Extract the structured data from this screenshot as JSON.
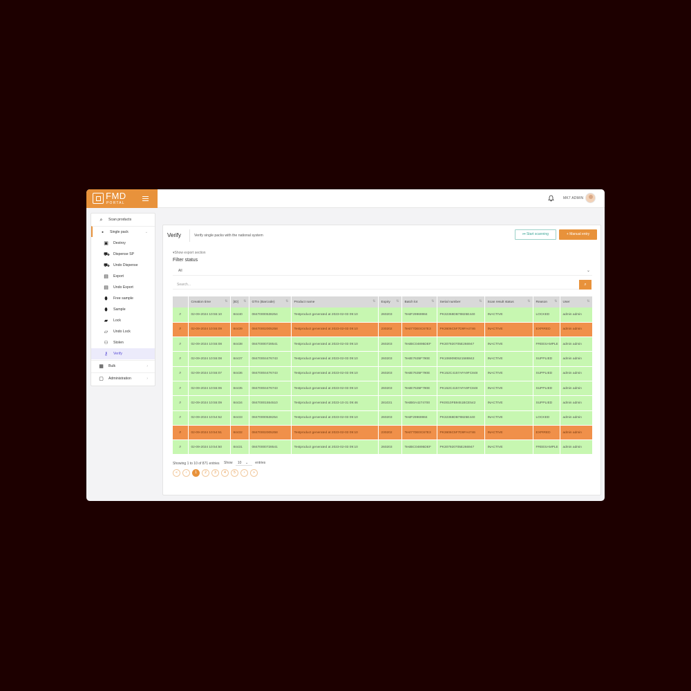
{
  "app": {
    "logo_text": "FMD",
    "logo_sub": "PORTAL",
    "username": "MK7 ADMIN"
  },
  "sidebar": {
    "items": [
      {
        "label": "Scan products",
        "icon": "search-icon"
      },
      {
        "label": "Single pack",
        "icon": "box-icon",
        "expanded": true
      },
      {
        "label": "Destroy",
        "icon": "destroy-icon"
      },
      {
        "label": "Dispense SP",
        "icon": "cart-icon"
      },
      {
        "label": "Undo Dispense",
        "icon": "undo-cart-icon"
      },
      {
        "label": "Export",
        "icon": "export-icon"
      },
      {
        "label": "Undo Export",
        "icon": "undo-export-icon"
      },
      {
        "label": "Free sample",
        "icon": "pill-icon"
      },
      {
        "label": "Sample",
        "icon": "pill-icon"
      },
      {
        "label": "Lock",
        "icon": "lock-icon"
      },
      {
        "label": "Undo Lock",
        "icon": "unlock-icon"
      },
      {
        "label": "Stolen",
        "icon": "people-icon"
      },
      {
        "label": "Verify",
        "icon": "key-icon",
        "active": true
      },
      {
        "label": "Bulk",
        "icon": "boxes-icon"
      },
      {
        "label": "Administration",
        "icon": "admin-icon"
      }
    ]
  },
  "page": {
    "title": "Verify",
    "subtitle": "Verify single packs with the national system",
    "start_scanning": "Start scanning",
    "manual_entry": "Manual entry",
    "export_link": "Show export section",
    "filter_label": "Filter status",
    "filter_value": "All",
    "search_placeholder": "Search..."
  },
  "table": {
    "columns": [
      "",
      "Creation time",
      "[ID]",
      "GTIn (Barcode)",
      "Product name",
      "Expiry",
      "Batch lot",
      "Serial number",
      "Scan result status",
      "Reason",
      "User"
    ],
    "rows": [
      {
        "status": "green",
        "cells": [
          "02-09-2024 10:55:10",
          "84440",
          "08470000538254",
          "Testproduct generated at 2023-02-03 09:10",
          "260203",
          "TestF29969984",
          "PK32368DB78825E440",
          "INACTIVE",
          "LOCKED",
          "admin admin"
        ]
      },
      {
        "status": "orange",
        "cells": [
          "02-09-2024 10:55:09",
          "84439",
          "08470002005258",
          "Testproduct generated at 2023-02-03 09:10",
          "230202",
          "Test77DE0C67E3",
          "PK3606C5F7D9FA4746",
          "INACTIVE",
          "EXPIRED",
          "admin admin"
        ]
      },
      {
        "status": "green",
        "cells": [
          "02-09-2024 10:55:08",
          "84438",
          "08470000728541",
          "Testproduct generated at 2023-02-03 09:10",
          "260203",
          "TestBC04895DEF",
          "PK307920705E266947",
          "INACTIVE",
          "FREESAMPLE",
          "admin admin"
        ]
      },
      {
        "status": "green",
        "cells": [
          "02-09-2024 10:55:08",
          "84437",
          "08470004476743",
          "Testproduct generated at 2023-02-03 09:10",
          "260203",
          "TestE7635F790E",
          "PK106909D521588842",
          "INACTIVE",
          "SUPPLIED",
          "admin admin"
        ]
      },
      {
        "status": "green",
        "cells": [
          "02-09-2024 10:55:07",
          "84436",
          "08470004476743",
          "Testproduct generated at 2023-02-03 09:10",
          "260203",
          "TestE7635F790E",
          "PK152C4157AFA9FC848",
          "INACTIVE",
          "SUPPLIED",
          "admin admin"
        ]
      },
      {
        "status": "green",
        "cells": [
          "02-09-2024 10:55:06",
          "84435",
          "08470004476743",
          "Testproduct generated at 2023-02-03 09:10",
          "260203",
          "TestE7635F790E",
          "PK152C4157AFA9FC848",
          "INACTIVE",
          "SUPPLIED",
          "admin admin"
        ]
      },
      {
        "status": "green",
        "cells": [
          "02-09-2024 10:55:09",
          "84434",
          "08470001554510",
          "Testproduct generated at 2023-10-31 09:46",
          "281031",
          "TestB0A4274700",
          "PK0010FB9451BCE542",
          "INACTIVE",
          "SUPPLIED",
          "admin admin"
        ]
      },
      {
        "status": "green",
        "cells": [
          "02-09-2024 10:54:52",
          "84433",
          "08470000538254",
          "Testproduct generated at 2023-02-03 09:10",
          "260203",
          "TestF29969984",
          "PK32368DB78825E440",
          "INACTIVE",
          "LOCKED",
          "admin admin"
        ]
      },
      {
        "status": "orange",
        "cells": [
          "02-09-2024 10:54:51",
          "84432",
          "08470002005258",
          "Testproduct generated at 2023-02-03 09:10",
          "230202",
          "Test77DE0C67E3",
          "PK3606C5F7D9FA4746",
          "INACTIVE",
          "EXPIRED",
          "admin admin"
        ]
      },
      {
        "status": "green",
        "cells": [
          "02-09-2024 10:54:50",
          "84431",
          "08470000728541",
          "Testproduct generated at 2023-02-03 09:10",
          "260203",
          "TestBC04895DEF",
          "PK307920705E266947",
          "INACTIVE",
          "FREESAMPLE",
          "admin admin"
        ]
      }
    ]
  },
  "footer": {
    "showing": "Showing 1 to 10 of 871 entries",
    "show_label": "Show",
    "page_size": "10",
    "entries_label": "entries",
    "pages": [
      "«",
      "‹",
      "1",
      "2",
      "3",
      "4",
      "5",
      "›",
      "»"
    ],
    "current_page": "1"
  },
  "colors": {
    "accent": "#e8923b",
    "row_ok": "#c7f7b1",
    "row_alert": "#f0904a",
    "active_nav": "#5b4fd6"
  }
}
